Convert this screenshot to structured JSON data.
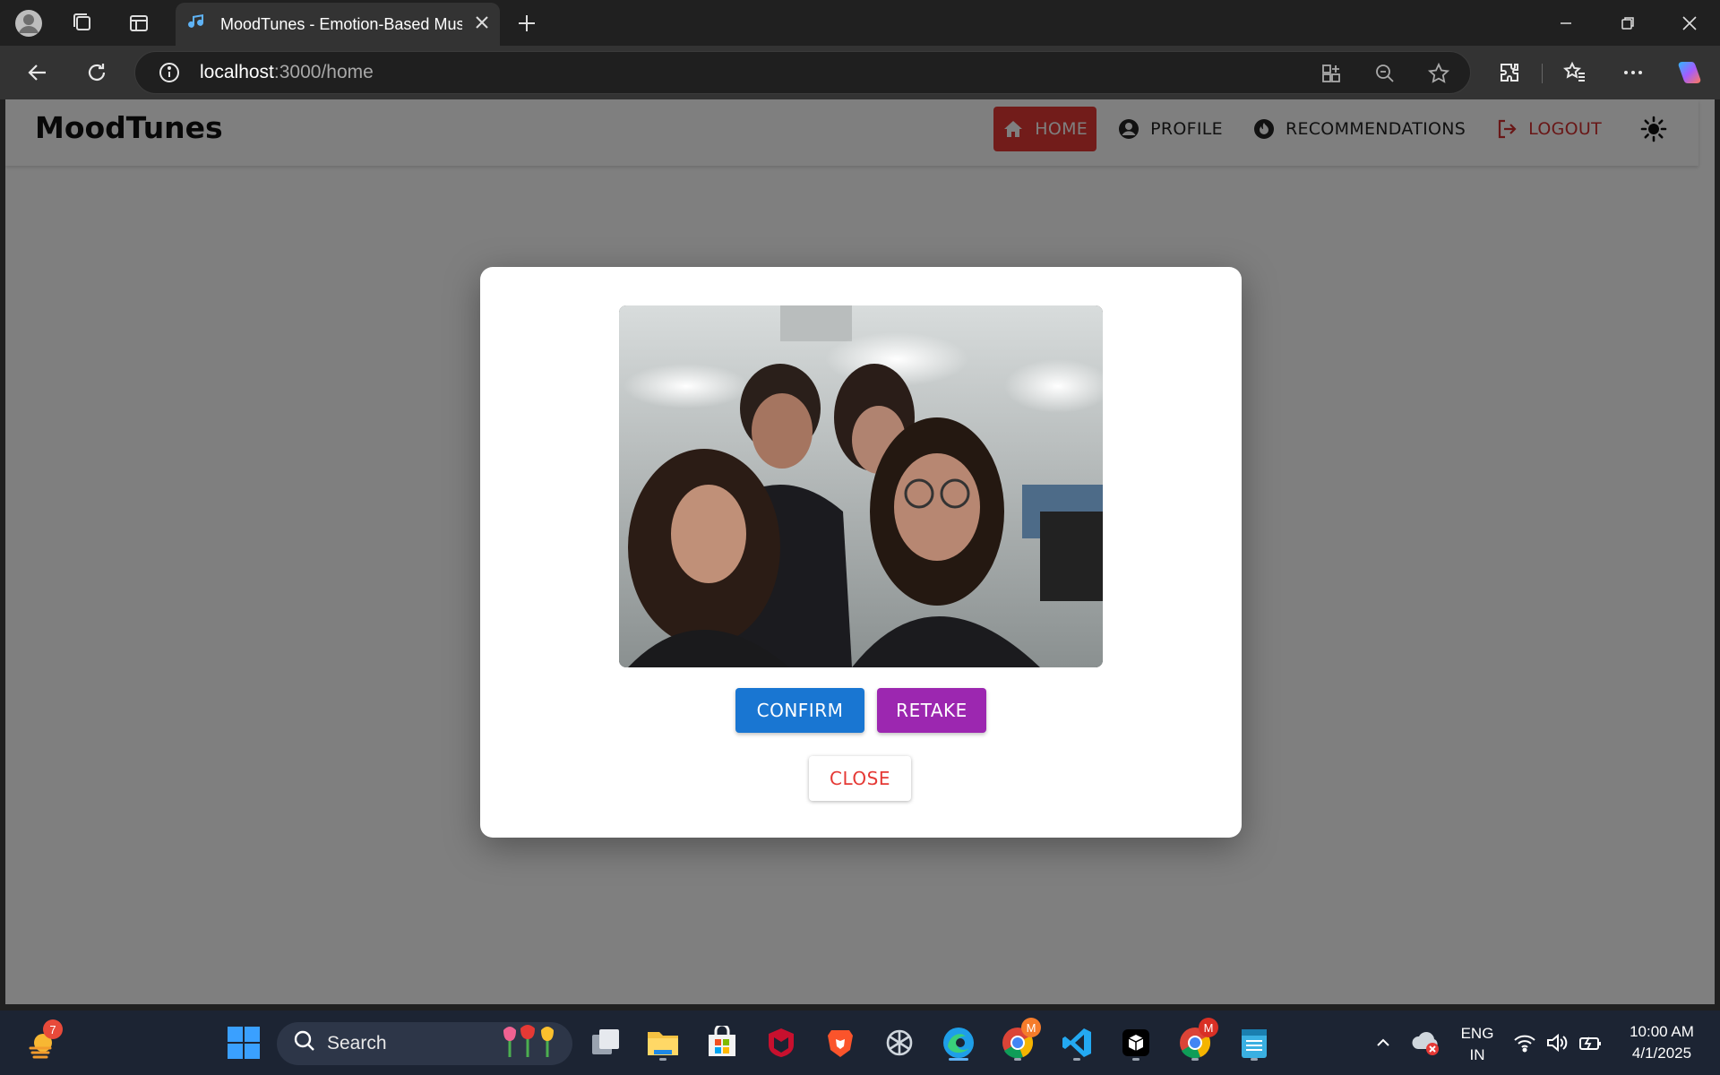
{
  "browser": {
    "tab_title": "MoodTunes - Emotion-Based Music",
    "url_host": "localhost",
    "url_path": ":3000/home"
  },
  "app": {
    "brand": "MoodTunes",
    "nav": {
      "home": "HOME",
      "profile": "PROFILE",
      "recommendations": "RECOMMENDATIONS",
      "logout": "LOGOUT"
    }
  },
  "dialog": {
    "confirm_label": "CONFIRM",
    "retake_label": "RETAKE",
    "close_label": "CLOSE"
  },
  "taskbar": {
    "search_label": "Search",
    "widgets_badge": "7",
    "chrome_badge": "M",
    "language_top": "ENG",
    "language_bottom": "IN",
    "time": "10:00 AM",
    "date": "4/1/2025"
  },
  "colors": {
    "home_active": "#e53935",
    "confirm": "#1976d2",
    "retake": "#9c27b0",
    "logout": "#d32f2f"
  }
}
